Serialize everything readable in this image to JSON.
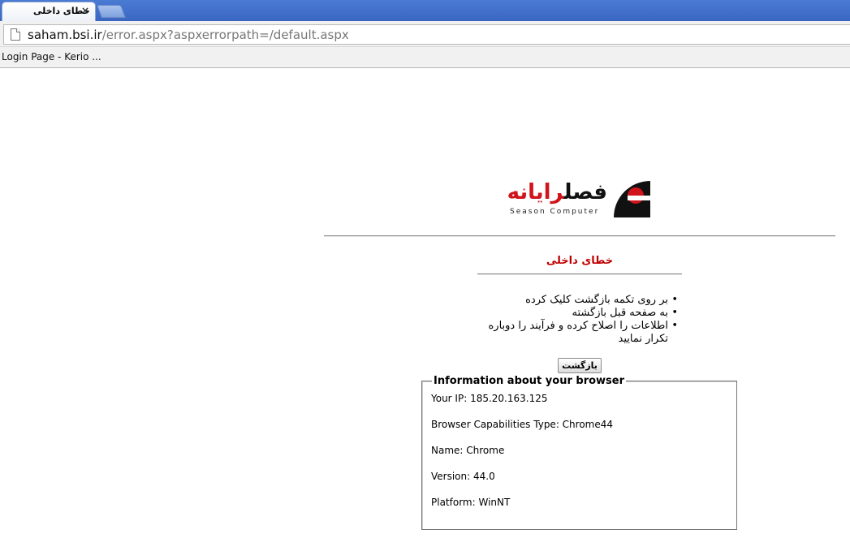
{
  "browser": {
    "tab_title": "خطای داخلی",
    "tab_close_glyph": "×",
    "url_host": "saham.bsi.ir",
    "url_path": "/error.aspx?aspxerrorpath=/default.aspx",
    "bookmarks": [
      {
        "label": "Login Page - Kerio ..."
      }
    ]
  },
  "logo": {
    "text_black": "فصل",
    "text_red": "رایانه",
    "subtitle": "Season Computer",
    "brand_red": "#d0141b",
    "brand_black": "#111111"
  },
  "error": {
    "title": "خطای داخلی",
    "title_color": "#c00000",
    "steps": [
      "بر روی تکمه بازگشت کلیک کرده",
      "به صفحه قبل بازگشته",
      "اطلاعات را اصلاح کرده و فرآیند را دوباره تکرار نمایید"
    ],
    "back_button_label": "بازگشت"
  },
  "browser_info": {
    "legend": "Information about your browser",
    "lines": [
      "Your IP: 185.20.163.125",
      "Browser Capabilities Type: Chrome44",
      "Name: Chrome",
      "Version: 44.0",
      "Platform: WinNT"
    ]
  }
}
